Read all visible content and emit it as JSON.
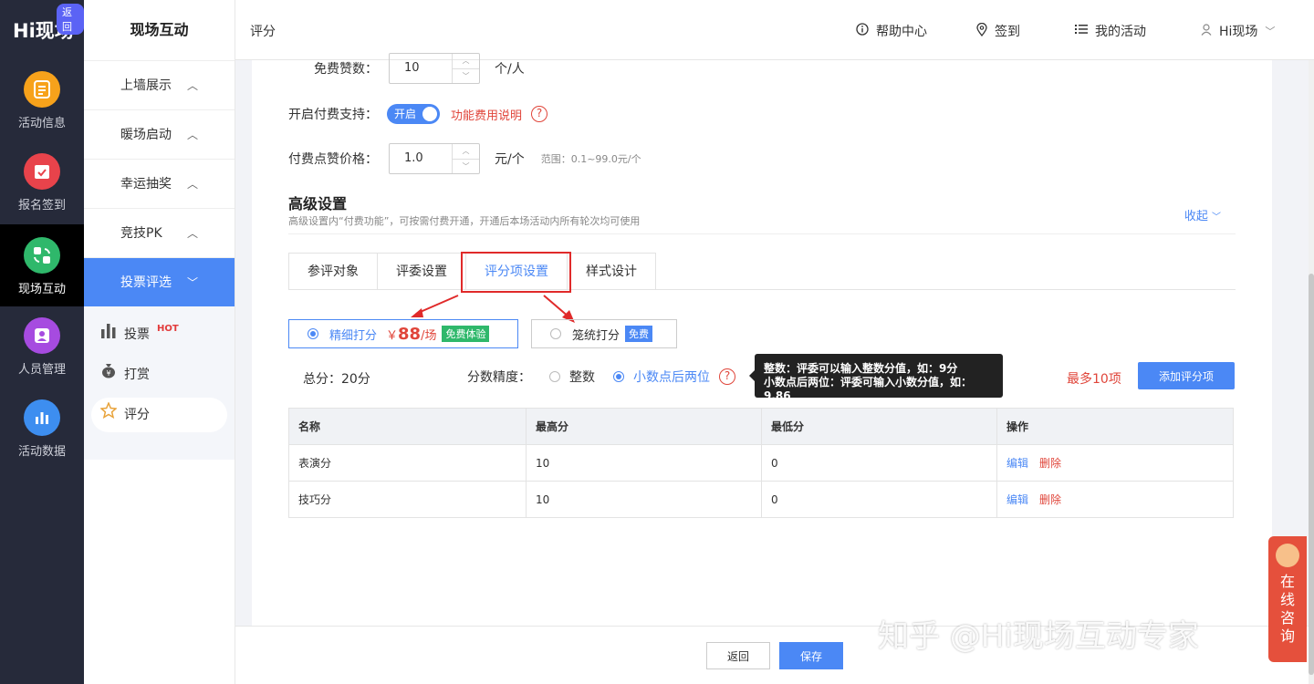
{
  "app": {
    "logo_hi": "Hi",
    "logo_name": "现场",
    "back_badge": "返回"
  },
  "main_nav": [
    {
      "label": "活动信息",
      "icon": "document-icon",
      "color": "#f7a21b"
    },
    {
      "label": "报名签到",
      "icon": "calendar-check-icon",
      "color": "#e8434b"
    },
    {
      "label": "现场互动",
      "icon": "interaction-icon",
      "color": "#2fb86b"
    },
    {
      "label": "人员管理",
      "icon": "person-icon",
      "color": "#a64be0"
    },
    {
      "label": "活动数据",
      "icon": "bar-chart-icon",
      "color": "#3d8ef0"
    }
  ],
  "sub_nav": {
    "title": "现场互动",
    "items": [
      "上墙展示",
      "暖场启动",
      "幸运抽奖",
      "竞技PK",
      "投票评选"
    ],
    "children": [
      {
        "label": "投票",
        "badge": "HOT",
        "icon": "bar-chart-icon"
      },
      {
        "label": "打赏",
        "icon": "money-bag-icon"
      },
      {
        "label": "评分",
        "icon": "star-icon"
      }
    ]
  },
  "topbar": {
    "breadcrumb": "评分",
    "help": "帮助中心",
    "checkin": "签到",
    "my_activities": "我的活动",
    "user": "Hi现场"
  },
  "form": {
    "free_likes_label": "免费赞数：",
    "free_likes_value": "10",
    "free_likes_unit": "个/人",
    "paid_support_label": "开启付费支持：",
    "toggle_label": "开启",
    "fee_link": "功能费用说明",
    "price_label": "付费点赞价格：",
    "price_value": "1.0",
    "price_unit": "元/个",
    "price_range": "范围：0.1~99.0元/个"
  },
  "advanced": {
    "title": "高级设置",
    "desc": "高级设置内“付费功能”，可按需付费开通，开通后本场活动内所有轮次均可使用",
    "collapse": "收起"
  },
  "tabs": [
    "参评对象",
    "评委设置",
    "评分项设置",
    "样式设计"
  ],
  "active_tab": 2,
  "modes": {
    "fine": {
      "label": "精细打分",
      "currency": "￥",
      "price": "88",
      "per": "/场",
      "tag": "免费体验"
    },
    "rough": {
      "label": "笼统打分",
      "tag": "免费"
    }
  },
  "scoring": {
    "total": "总分：20分",
    "precision_label": "分数精度：",
    "opt_integer": "整数",
    "opt_decimal": "小数点后两位",
    "tooltip_line1": "整数：评委可以输入整数分值，如：9分",
    "tooltip_line2": "小数点后两位：评委可输入小数分值，如：9.86",
    "max_items": "最多10项",
    "add_button": "添加评分项"
  },
  "table": {
    "headers": [
      "名称",
      "最高分",
      "最低分",
      "操作"
    ],
    "rows": [
      {
        "name": "表演分",
        "max": "10",
        "min": "0"
      },
      {
        "name": "技巧分",
        "max": "10",
        "min": "0"
      }
    ],
    "edit": "编辑",
    "delete": "删除"
  },
  "footer": {
    "back": "返回",
    "save": "保存"
  },
  "watermark": "知乎 @Hi现场互动专家",
  "consult": [
    "在",
    "线",
    "咨",
    "询"
  ]
}
